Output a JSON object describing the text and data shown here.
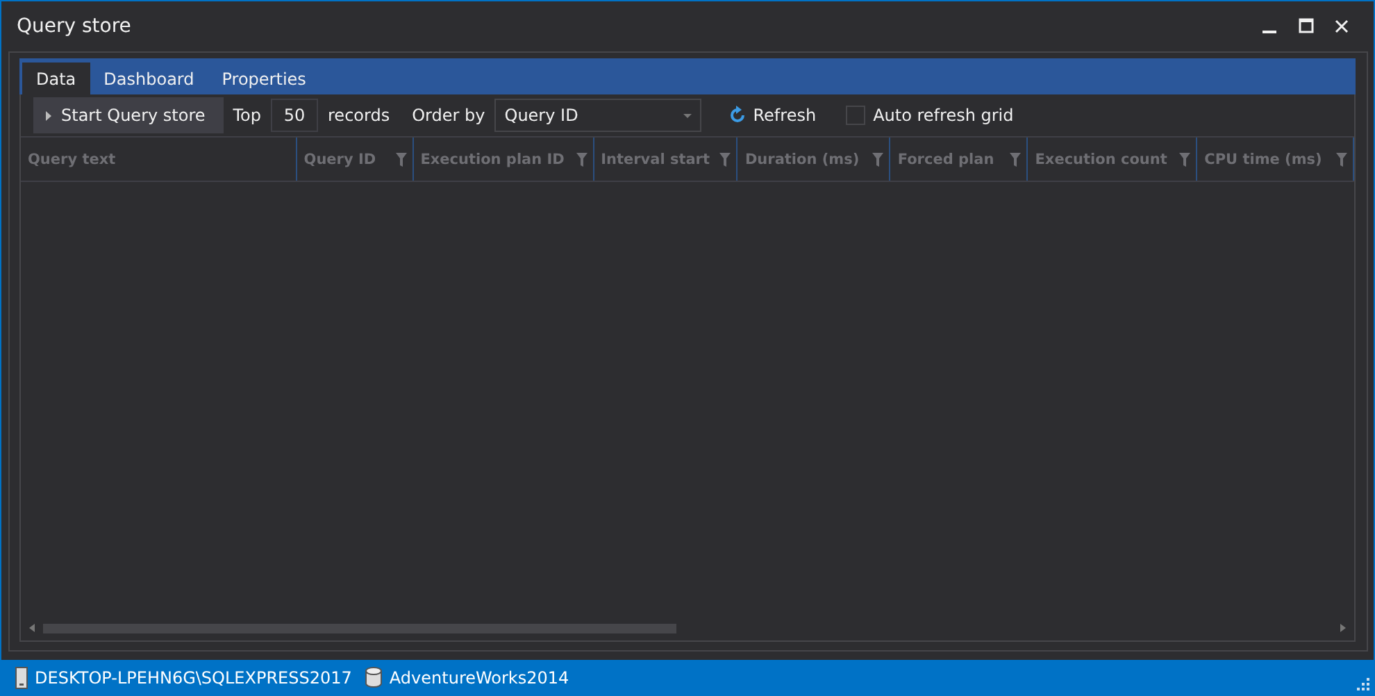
{
  "window": {
    "title": "Query store"
  },
  "tabs": [
    {
      "label": "Data",
      "selected": true
    },
    {
      "label": "Dashboard",
      "selected": false
    },
    {
      "label": "Properties",
      "selected": false
    }
  ],
  "toolbar": {
    "start_button": "Start Query store",
    "top_label": "Top",
    "top_value": "50",
    "records_label": "records",
    "order_label": "Order by",
    "order_value": "Query ID",
    "refresh": "Refresh",
    "auto_refresh": {
      "label": "Auto refresh grid",
      "checked": false
    }
  },
  "table": {
    "columns": [
      {
        "label": "Query text",
        "filter": false
      },
      {
        "label": "Query ID",
        "filter": true
      },
      {
        "label": "Execution plan ID",
        "filter": true
      },
      {
        "label": "Interval start",
        "filter": true
      },
      {
        "label": "Duration (ms)",
        "filter": true
      },
      {
        "label": "Forced plan",
        "filter": true
      },
      {
        "label": "Execution count",
        "filter": true
      },
      {
        "label": "CPU time (ms)",
        "filter": true
      }
    ]
  },
  "status_bar": {
    "server": "DESKTOP-LPEHN6G\\SQLEXPRESS2017",
    "database": "AdventureWorks2014"
  }
}
